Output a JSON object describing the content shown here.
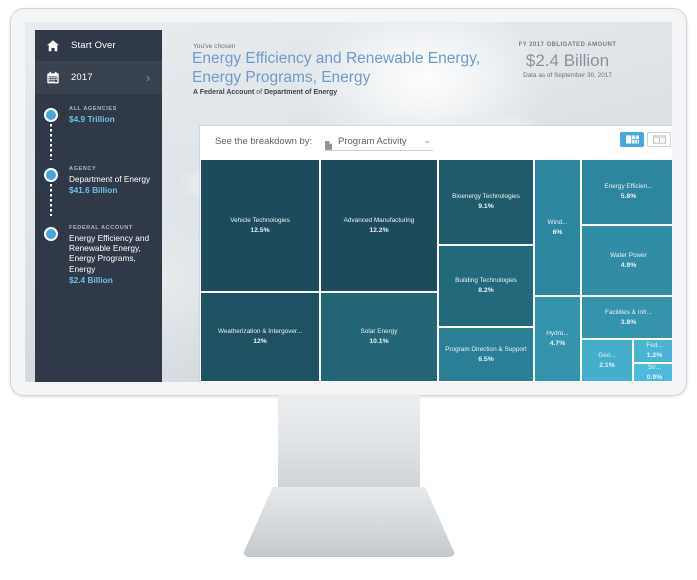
{
  "sidebar": {
    "start_over": {
      "label": "Start Over",
      "icon": "home-icon"
    },
    "year": {
      "label": "2017",
      "icon": "calendar-icon",
      "chevron": "›"
    },
    "trail": [
      {
        "kicker": "ALL AGENCIES",
        "name": "",
        "amount": "$4.9 Trillion"
      },
      {
        "kicker": "AGENCY",
        "name": "Department of Energy",
        "amount": "$41.6 Billion"
      },
      {
        "kicker": "FEDERAL ACCOUNT",
        "name": "Energy Efficiency and Renewable Energy, Energy Programs, Energy",
        "amount": "$2.4 Billion"
      }
    ]
  },
  "header": {
    "kicker": "You've chosen",
    "title": "Energy Efficiency and Renewable Energy, Energy Programs, Energy",
    "subtitle_strong_1": "A Federal Account",
    "subtitle_mid": " of ",
    "subtitle_strong_2": "Department of Energy",
    "amount_kicker": "FY 2017 OBLIGATED AMOUNT",
    "amount_value": "$2.4 Billion",
    "amount_asof": "Data as of September 30, 2017"
  },
  "toolbar": {
    "breakdown_label": "See the breakdown by:",
    "select_value": "Program Activity",
    "select_icon": "document-icon",
    "caret": "⌄",
    "treemap_toggle": "treemap-view-icon",
    "table_toggle": "table-view-icon"
  },
  "chart_data": {
    "type": "treemap",
    "title": "Energy Efficiency and Renewable Energy, Energy Programs, Energy",
    "value_label": "FY 2017 Obligated Amount",
    "total": "$2.4 Billion",
    "unit": "percent",
    "tiles": [
      {
        "name": "Vehicle Technologies",
        "pct": "12.5%",
        "value": 12.5,
        "color": "#1c4c5c"
      },
      {
        "name": "Advanced Manufacturing",
        "pct": "12.2%",
        "value": 12.2,
        "color": "#1c4c5c"
      },
      {
        "name": "Weatherization & Intergover...",
        "pct": "12%",
        "value": 12.0,
        "color": "#1e5263"
      },
      {
        "name": "Solar Energy",
        "pct": "10.1%",
        "value": 10.1,
        "color": "#246577"
      },
      {
        "name": "Bioenergy Technologies",
        "pct": "9.1%",
        "value": 9.1,
        "color": "#205b6c"
      },
      {
        "name": "Building Technologies",
        "pct": "8.2%",
        "value": 8.2,
        "color": "#23697c"
      },
      {
        "name": "Program Direction & Support",
        "pct": "6.5%",
        "value": 6.5,
        "color": "#2a7f96"
      },
      {
        "name": "Wind...",
        "pct": "6%",
        "value": 6.0,
        "color": "#2d86a0"
      },
      {
        "name": "Energy Efficien...",
        "pct": "5.8%",
        "value": 5.8,
        "color": "#2d86a0"
      },
      {
        "name": "Water Power",
        "pct": "4.9%",
        "value": 4.9,
        "color": "#318da6"
      },
      {
        "name": "Hydro...",
        "pct": "4.7%",
        "value": 4.7,
        "color": "#3493ad"
      },
      {
        "name": "Facilities & Infr...",
        "pct": "3.8%",
        "value": 3.8,
        "color": "#3493ad"
      },
      {
        "name": "Geo...",
        "pct": "2.1%",
        "value": 2.1,
        "color": "#45aecd"
      },
      {
        "name": "Fed...",
        "pct": "1.2%",
        "value": 1.2,
        "color": "#49b4d4"
      },
      {
        "name": "Str...",
        "pct": "0.9%",
        "value": 0.9,
        "color": "#4dbbdb"
      }
    ]
  }
}
